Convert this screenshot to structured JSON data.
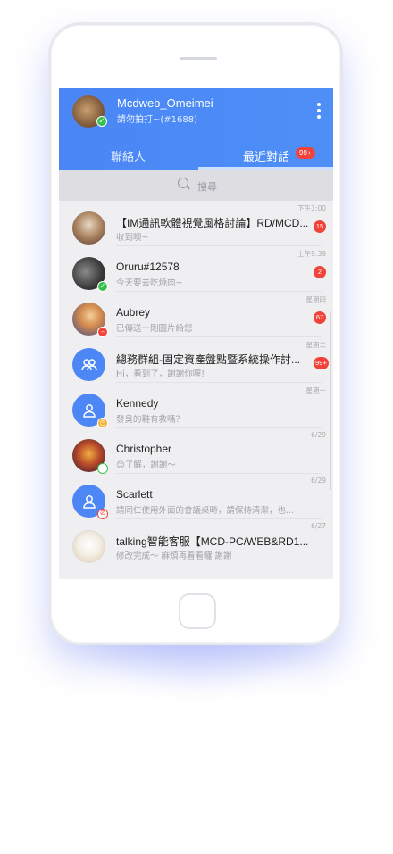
{
  "me": {
    "name": "Mcdweb_Omeimei",
    "status": "請勿拍打~(#1688)"
  },
  "tabs": [
    {
      "label": "聯絡人"
    },
    {
      "label": "最近對話",
      "badge": "99+"
    }
  ],
  "search": {
    "placeholder": "搜尋"
  },
  "chats": [
    {
      "title": "【IM通訊軟體視覺風格討論】RD/MCD...",
      "subtitle": "收到噢~",
      "time": "下午3:00",
      "badge": "15"
    },
    {
      "title": "Oruru#12578",
      "subtitle": "今天要去吃燒肉~",
      "time": "上午9:39",
      "badge": "2"
    },
    {
      "title": "Aubrey",
      "subtitle": "已傳送一則圖片給您",
      "time": "星期四",
      "badge": "67"
    },
    {
      "title": "總務群組-固定資產盤點暨系統操作討...",
      "subtitle": "Hi，看到了，謝謝你喔!",
      "time": "星期二",
      "badge": "99+"
    },
    {
      "title": "Kennedy",
      "subtitle": "發臭的鞋有救嗎？",
      "time": "星期一",
      "badge": ""
    },
    {
      "title": "Christopher",
      "subtitle": "😊了解，謝謝～",
      "time": "6/29",
      "badge": ""
    },
    {
      "title": "Scarlett",
      "subtitle": "請同仁使用外面的會議桌時，請保持清潔，也...",
      "time": "6/29",
      "badge": ""
    },
    {
      "title": "talking智能客服【MCD-PC/WEB&RD1...",
      "subtitle": "修改完成～ 麻煩再看看囉 謝謝",
      "time": "6/27",
      "badge": ""
    }
  ]
}
